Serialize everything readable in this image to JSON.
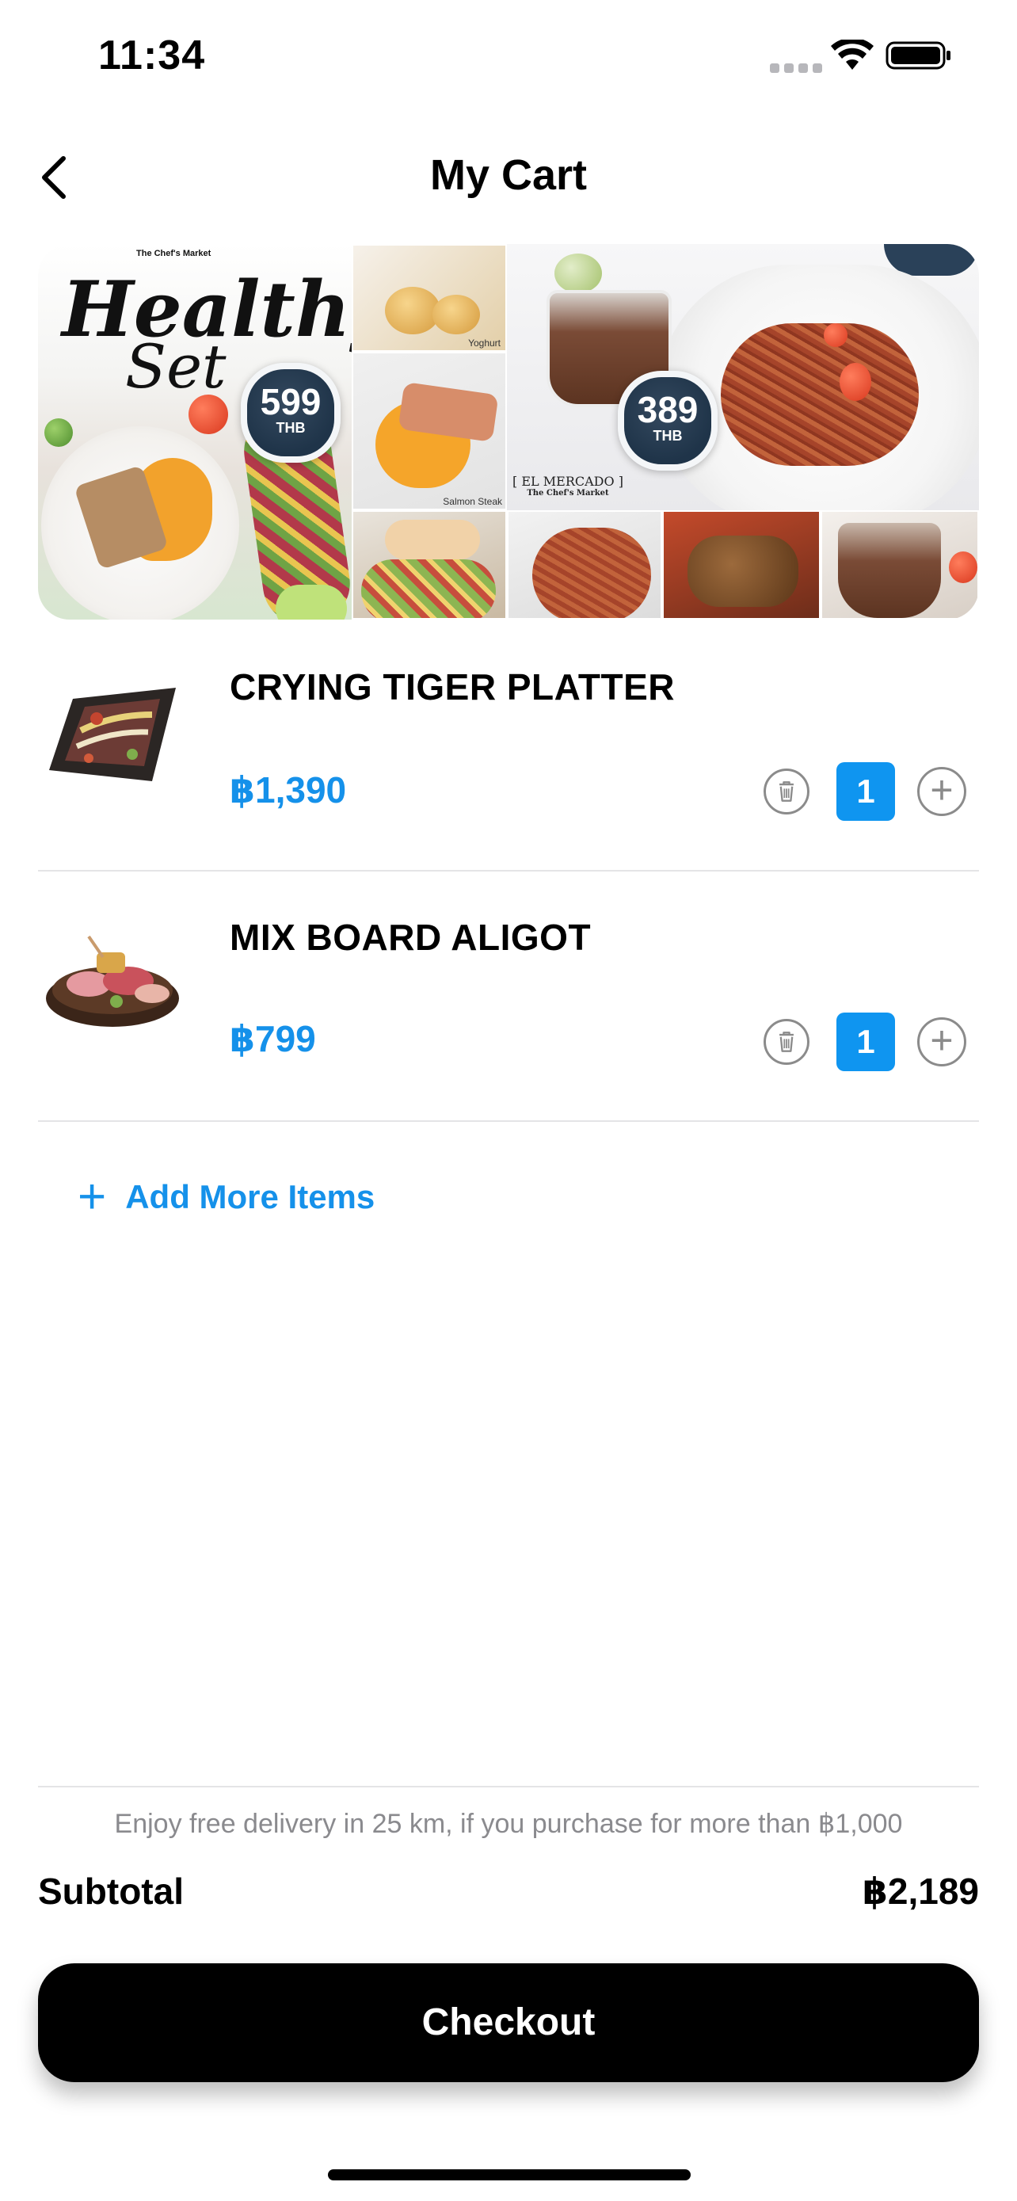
{
  "status_bar": {
    "time": "11:34"
  },
  "header": {
    "title": "My Cart"
  },
  "banner": {
    "brand_small": "The Chef's Market",
    "headline_1": "Healthy",
    "headline_2": "Set",
    "price_badge_1": {
      "value": "599",
      "unit": "THB"
    },
    "price_badge_2": {
      "value": "389",
      "unit": "THB"
    },
    "caption_yoghurt": "Yoghurt",
    "caption_salmon": "Salmon Steak",
    "mercado": "[ EL MERCADO ]",
    "mercado_sub": "The Chef's Market"
  },
  "cart": {
    "items": [
      {
        "name": "CRYING TIGER PLATTER",
        "price": "฿1,390",
        "quantity": "1"
      },
      {
        "name": "MIX BOARD ALIGOT",
        "price": "฿799",
        "quantity": "1"
      }
    ],
    "add_more_label": "Add More Items"
  },
  "footer": {
    "delivery_note": "Enjoy free delivery in 25 km, if you purchase for more than ฿1,000",
    "subtotal_label": "Subtotal",
    "subtotal_value": "฿2,189",
    "checkout_label": "Checkout"
  },
  "colors": {
    "accent": "#1591ea",
    "qty_bg": "#0f95f0",
    "button": "#000000"
  },
  "icons": [
    "back-chevron-icon",
    "cellular-signal-icon",
    "wifi-icon",
    "battery-icon",
    "trash-icon",
    "plus-circle-icon",
    "plus-icon"
  ]
}
